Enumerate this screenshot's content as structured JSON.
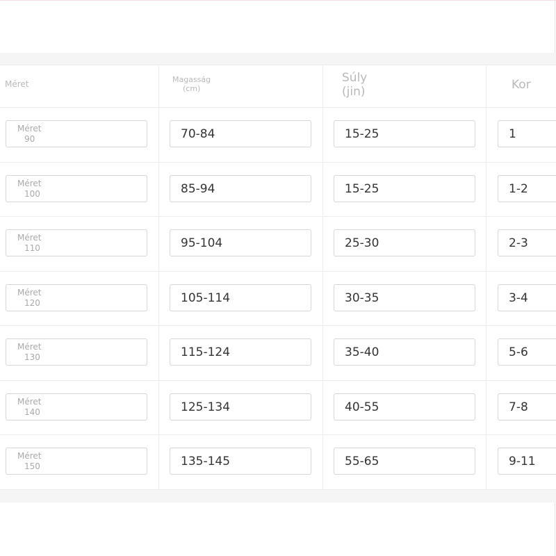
{
  "header": {
    "size": "Méret",
    "height": [
      "Magasság",
      "(cm)"
    ],
    "weight": [
      "Súly",
      "(jin)"
    ],
    "age": "Kor"
  },
  "size_label": "Méret",
  "rows": [
    {
      "size": "90",
      "height": "70-84",
      "weight": "15-25",
      "age": "1"
    },
    {
      "size": "100",
      "height": "85-94",
      "weight": "15-25",
      "age": "1-2"
    },
    {
      "size": "110",
      "height": "95-104",
      "weight": "25-30",
      "age": "2-3"
    },
    {
      "size": "120",
      "height": "105-114",
      "weight": "30-35",
      "age": "3-4"
    },
    {
      "size": "130",
      "height": "115-124",
      "weight": "35-40",
      "age": "5-6"
    },
    {
      "size": "140",
      "height": "125-134",
      "weight": "40-55",
      "age": "7-8"
    },
    {
      "size": "150",
      "height": "135-145",
      "weight": "55-65",
      "age": "9-11"
    }
  ]
}
